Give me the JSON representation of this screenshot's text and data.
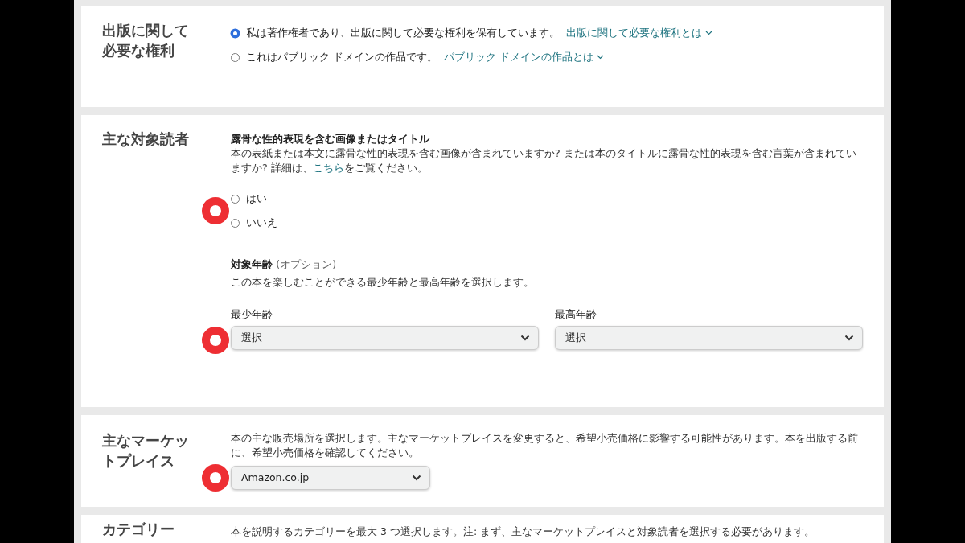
{
  "sections": [
    {
      "kind": "rights",
      "title": "出版に関して必要な権利",
      "options": [
        {
          "label": "私は著作権者であり、出版に関して必要な権利を保有しています。",
          "link": "出版に関して必要な権利とは",
          "selected": true
        },
        {
          "label": "これはパブリック ドメインの作品です。",
          "link": "パブリック ドメインの作品とは",
          "selected": false
        }
      ]
    },
    {
      "kind": "audience",
      "title": "主な対象読者",
      "explicit": {
        "heading": "露骨な性的表現を含む画像またはタイトル",
        "text_before": "本の表紙または本文に露骨な性的表現を含む画像が含まれていますか? または本のタイトルに露骨な性的表現を含む言葉が含まれていますか? 詳細は、",
        "link": "こちら",
        "text_after": "をご覧ください。",
        "options": [
          {
            "label": "はい",
            "selected": false
          },
          {
            "label": "いいえ",
            "selected": false
          }
        ]
      },
      "age": {
        "heading": "対象年齢",
        "note": "(オプション)",
        "description": "この本を楽しむことができる最少年齢と最高年齢を選択します。",
        "selects": [
          {
            "label": "最少年齢",
            "value": "選択"
          },
          {
            "label": "最高年齢",
            "value": "選択"
          }
        ]
      }
    },
    {
      "kind": "marketplace",
      "title": "主なマーケットプレイス",
      "description": "本の主な販売場所を選択します。主なマーケットプレイスを変更すると、希望小売価格に影響する可能性があります。本を出版する前に、希望小売価格を確認してください。",
      "select": {
        "value": "Amazon.co.jp"
      }
    },
    {
      "kind": "categories",
      "title": "カテゴリー",
      "description": "本を説明するカテゴリーを最大 3 つ選択します。注: まず、主なマーケットプレイスと対象読者を選択する必要があります。"
    }
  ]
}
